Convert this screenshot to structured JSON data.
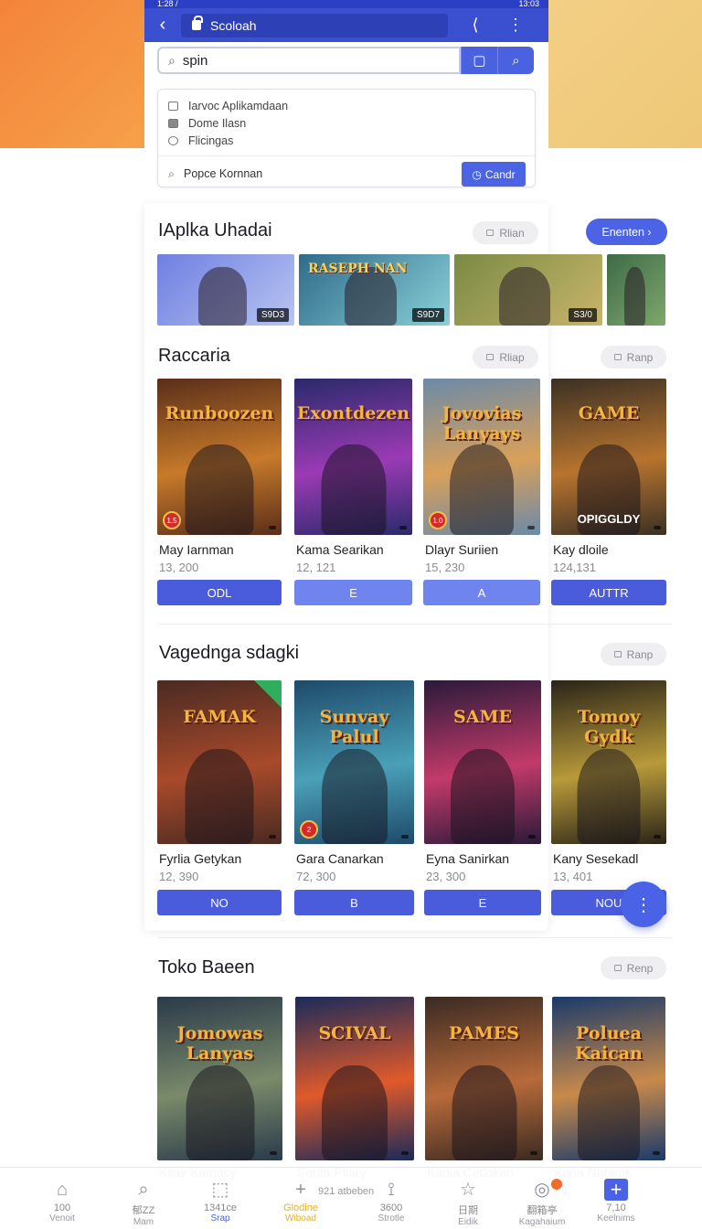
{
  "status_bar": {
    "time": "1:28 /",
    "right": "13:03"
  },
  "browser": {
    "back_icon": "chevron-left-icon",
    "url": "Scoloah",
    "share_icon": "share-icon",
    "more_icon": "more-vertical-icon"
  },
  "search": {
    "value": "spin",
    "btn1_icon": "clipboard-icon",
    "btn2_icon": "search-icon"
  },
  "suggestions": {
    "items": [
      "Iarvoc Aplikamdaan",
      "Dome Ilasn",
      "Flicingas"
    ],
    "bottom_text": "Popce Kornnan",
    "bottom_button": "Candr"
  },
  "sections": {
    "s1": {
      "title": "IAplka Uhadai",
      "pill": "Rlian",
      "blue_pill": "Enenten ›"
    },
    "s2": {
      "title": "Raccaria",
      "pill1": "Rliap",
      "pill2": "Ranp"
    },
    "s3": {
      "title": "Vagednga sdagki",
      "pill": "Ranp"
    },
    "s4": {
      "title": "Toko Baeen",
      "pill": "Renp"
    }
  },
  "banners": [
    {
      "title": "",
      "tag": "S9D3",
      "colors": [
        "#6f7fe0",
        "#b8c4f2"
      ]
    },
    {
      "title": "RASEPH NAN",
      "tag": "S9D7",
      "colors": [
        "#2f6b8a",
        "#8ad0d8"
      ]
    },
    {
      "title": "",
      "tag": "S3/0",
      "colors": [
        "#7a8a44",
        "#c9b56a"
      ]
    },
    {
      "title": "",
      "tag": "",
      "colors": [
        "#3d6a48",
        "#7fa86b"
      ]
    }
  ],
  "row1": [
    {
      "art": "Runboozen",
      "name": "May Iarnman",
      "count": "13, 200",
      "btn": "ODL",
      "light": false,
      "badge": "1.5",
      "colors": [
        "#5a2e1a",
        "#c77a2a"
      ]
    },
    {
      "art": "Exontdezen",
      "name": "Kama Searikan",
      "count": "12, 121",
      "btn": "E",
      "light": true,
      "badge": "",
      "colors": [
        "#2a2a6a",
        "#9b3ab5"
      ]
    },
    {
      "art": "Jovovias Lanyays",
      "name": "Dlayr Suriien",
      "count": "15, 230",
      "btn": "A",
      "light": true,
      "badge": "1.0",
      "colors": [
        "#6b8aa8",
        "#d9a05a"
      ]
    },
    {
      "art": "GAME",
      "name": "Kay dloile",
      "count": "124,131",
      "btn": "AUTTR",
      "light": false,
      "badge": "",
      "colors": [
        "#3a3024",
        "#b8742e"
      ]
    }
  ],
  "row1_labels": [
    "OPIGGLDY"
  ],
  "row2": [
    {
      "art": "FAMAK",
      "name": "Fyrlia Getykan",
      "count": "12, 390",
      "btn": "NO",
      "light": false,
      "badge": "",
      "colors": [
        "#4a2a22",
        "#a84a2a"
      ]
    },
    {
      "art": "Sunvay Palul",
      "name": "Gara Canarkan",
      "count": "72, 300",
      "btn": "B",
      "light": false,
      "badge": "2",
      "colors": [
        "#1e4a6a",
        "#4aa0b8"
      ]
    },
    {
      "art": "SAME",
      "name": "Eyna Sanirkan",
      "count": "23, 300",
      "btn": "E",
      "light": false,
      "badge": "",
      "colors": [
        "#2a1a3a",
        "#c23a6a"
      ]
    },
    {
      "art": "Tomoy Gydk",
      "name": "Kany Sesekadl",
      "count": "13, 401",
      "btn": "NOU",
      "light": false,
      "badge": "",
      "colors": [
        "#2a2418",
        "#b89a3a"
      ]
    }
  ],
  "row3": [
    {
      "art": "Jomowas Lanyas",
      "name": "Kliay Kamacy",
      "count": "",
      "colors": [
        "#2a3a4a",
        "#7a8a6a"
      ]
    },
    {
      "art": "SCIVAL",
      "name": "Sorita Pliary",
      "count": "",
      "colors": [
        "#1a2a5a",
        "#e05a2a"
      ]
    },
    {
      "art": "PAMES",
      "name": "Kania Cetlokan",
      "count": "",
      "colors": [
        "#3a2a22",
        "#b86a3a"
      ]
    },
    {
      "art": "Poluea Kaican",
      "name": "Kana Natamk",
      "count": "",
      "colors": [
        "#1a3a6a",
        "#c88a4a"
      ]
    }
  ],
  "fab_icon": "more-vertical-icon",
  "bottom_nav": [
    {
      "icon": "home-icon",
      "l1": "100",
      "l2": "Venoit"
    },
    {
      "icon": "search-icon",
      "l1": "郁ZZ",
      "l2": "Mam"
    },
    {
      "icon": "share-box-icon",
      "l1": "1341ce",
      "l2": "Srap"
    },
    {
      "icon": "plus-icon",
      "l1": "Glodine",
      "l2": "Wiboad"
    },
    {
      "icon": "tower-icon",
      "l1": "3600",
      "l2": "Strotle"
    },
    {
      "icon": "star-icon",
      "l1": "日期",
      "l2": "Eidik"
    },
    {
      "icon": "globe-icon",
      "l1": "翻箱亭",
      "l2": "Kagahaium"
    },
    {
      "icon": "add-square-icon",
      "l1": "7,10",
      "l2": "Keelnims"
    }
  ],
  "bottom_extra": "921 atbeben"
}
